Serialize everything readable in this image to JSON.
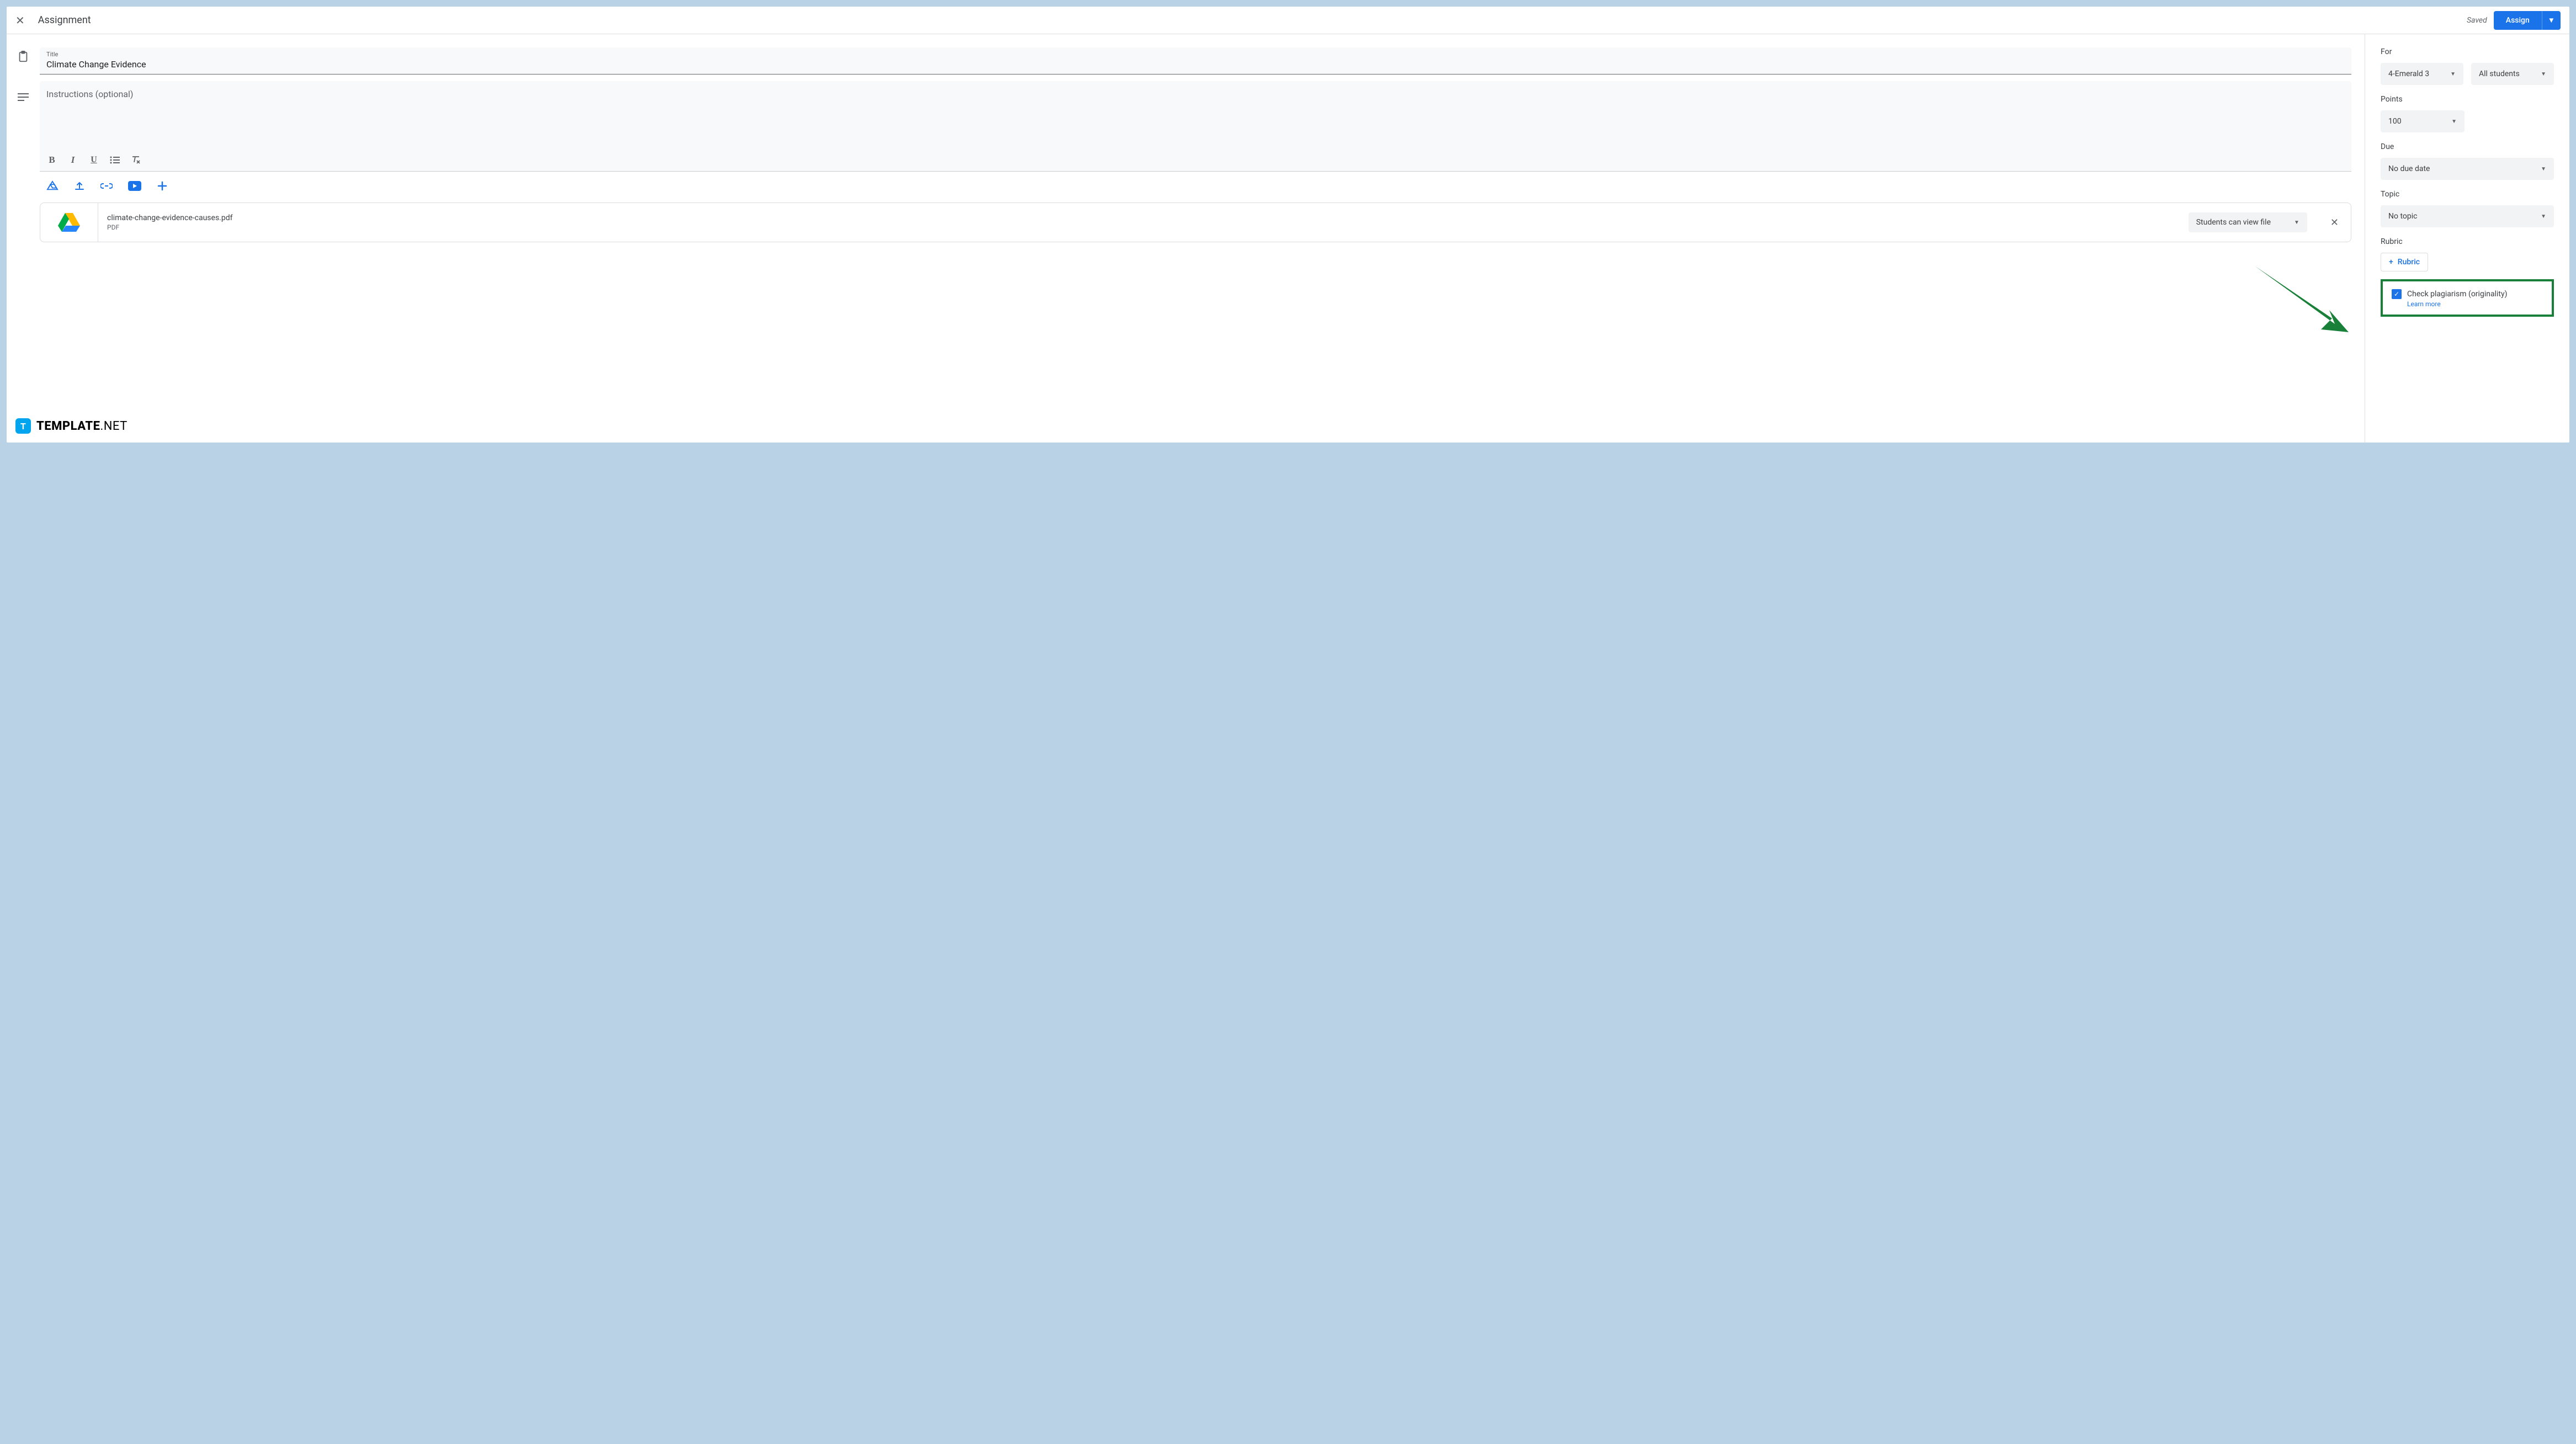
{
  "header": {
    "title": "Assignment",
    "saved": "Saved",
    "assign": "Assign"
  },
  "form": {
    "title_label": "Title",
    "title_value": "Climate Change Evidence",
    "instructions_placeholder": "Instructions (optional)"
  },
  "attachment": {
    "filename": "climate-change-evidence-causes.pdf",
    "filetype": "PDF",
    "permission": "Students can view file"
  },
  "sidebar": {
    "for_label": "For",
    "class_value": "4-Emerald 3",
    "students_value": "All students",
    "points_label": "Points",
    "points_value": "100",
    "due_label": "Due",
    "due_value": "No due date",
    "topic_label": "Topic",
    "topic_value": "No topic",
    "rubric_label": "Rubric",
    "rubric_button": "Rubric",
    "plagiarism_label": "Check plagiarism (originality)",
    "learn_more": "Learn more"
  },
  "watermark": {
    "brand": "TEMPLATE",
    "suffix": ".NET"
  }
}
